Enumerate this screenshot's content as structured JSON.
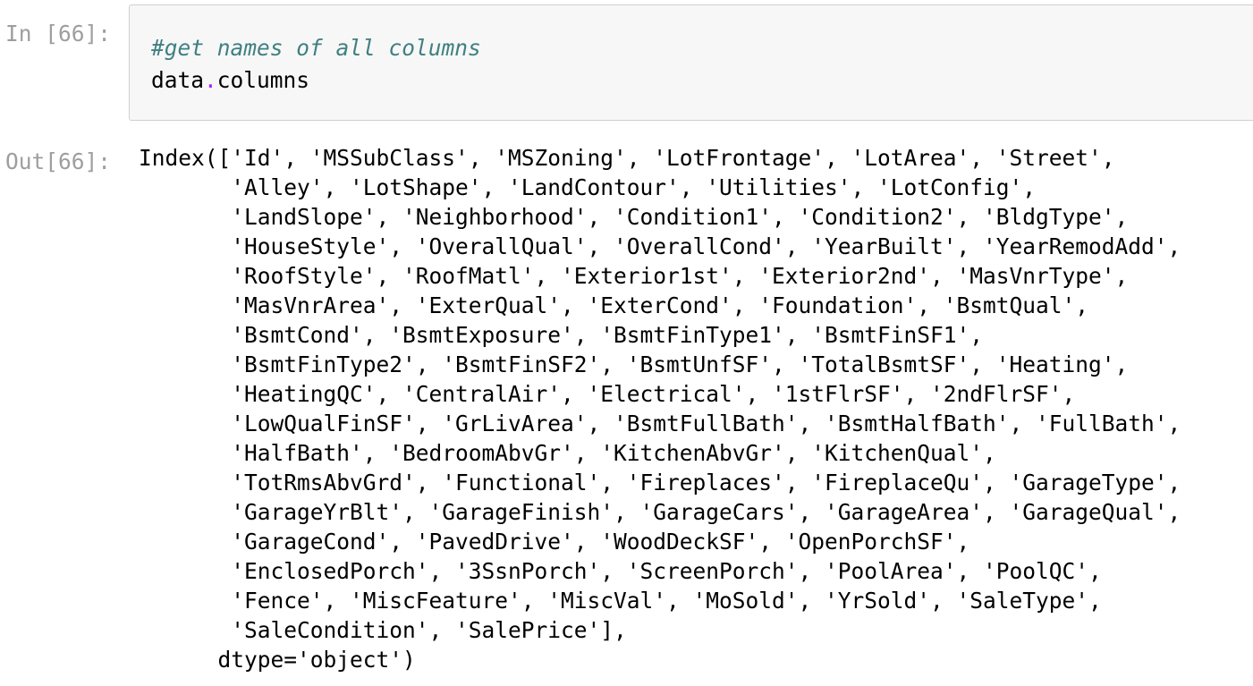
{
  "input_cell": {
    "prompt": "In [66]:",
    "comment": "#get names of all columns",
    "code_object": "data",
    "code_dot": ".",
    "code_attr": "columns"
  },
  "output_cell": {
    "prompt": "Out[66]:",
    "lines": [
      "Index(['Id', 'MSSubClass', 'MSZoning', 'LotFrontage', 'LotArea', 'Street',",
      "       'Alley', 'LotShape', 'LandContour', 'Utilities', 'LotConfig',",
      "       'LandSlope', 'Neighborhood', 'Condition1', 'Condition2', 'BldgType',",
      "       'HouseStyle', 'OverallQual', 'OverallCond', 'YearBuilt', 'YearRemodAdd',",
      "       'RoofStyle', 'RoofMatl', 'Exterior1st', 'Exterior2nd', 'MasVnrType',",
      "       'MasVnrArea', 'ExterQual', 'ExterCond', 'Foundation', 'BsmtQual',",
      "       'BsmtCond', 'BsmtExposure', 'BsmtFinType1', 'BsmtFinSF1',",
      "       'BsmtFinType2', 'BsmtFinSF2', 'BsmtUnfSF', 'TotalBsmtSF', 'Heating',",
      "       'HeatingQC', 'CentralAir', 'Electrical', '1stFlrSF', '2ndFlrSF',",
      "       'LowQualFinSF', 'GrLivArea', 'BsmtFullBath', 'BsmtHalfBath', 'FullBath',",
      "       'HalfBath', 'BedroomAbvGr', 'KitchenAbvGr', 'KitchenQual',",
      "       'TotRmsAbvGrd', 'Functional', 'Fireplaces', 'FireplaceQu', 'GarageType',",
      "       'GarageYrBlt', 'GarageFinish', 'GarageCars', 'GarageArea', 'GarageQual',",
      "       'GarageCond', 'PavedDrive', 'WoodDeckSF', 'OpenPorchSF',",
      "       'EnclosedPorch', '3SsnPorch', 'ScreenPorch', 'PoolArea', 'PoolQC',",
      "       'Fence', 'MiscFeature', 'MiscVal', 'MoSold', 'YrSold', 'SaleType',",
      "       'SaleCondition', 'SalePrice'],",
      "      dtype='object')"
    ]
  },
  "colors": {
    "prompt": "#9e9e9e",
    "comment": "#408080",
    "operator": "#aa22ff",
    "input_background": "#f7f7f7",
    "input_border": "#cfcfcf"
  }
}
